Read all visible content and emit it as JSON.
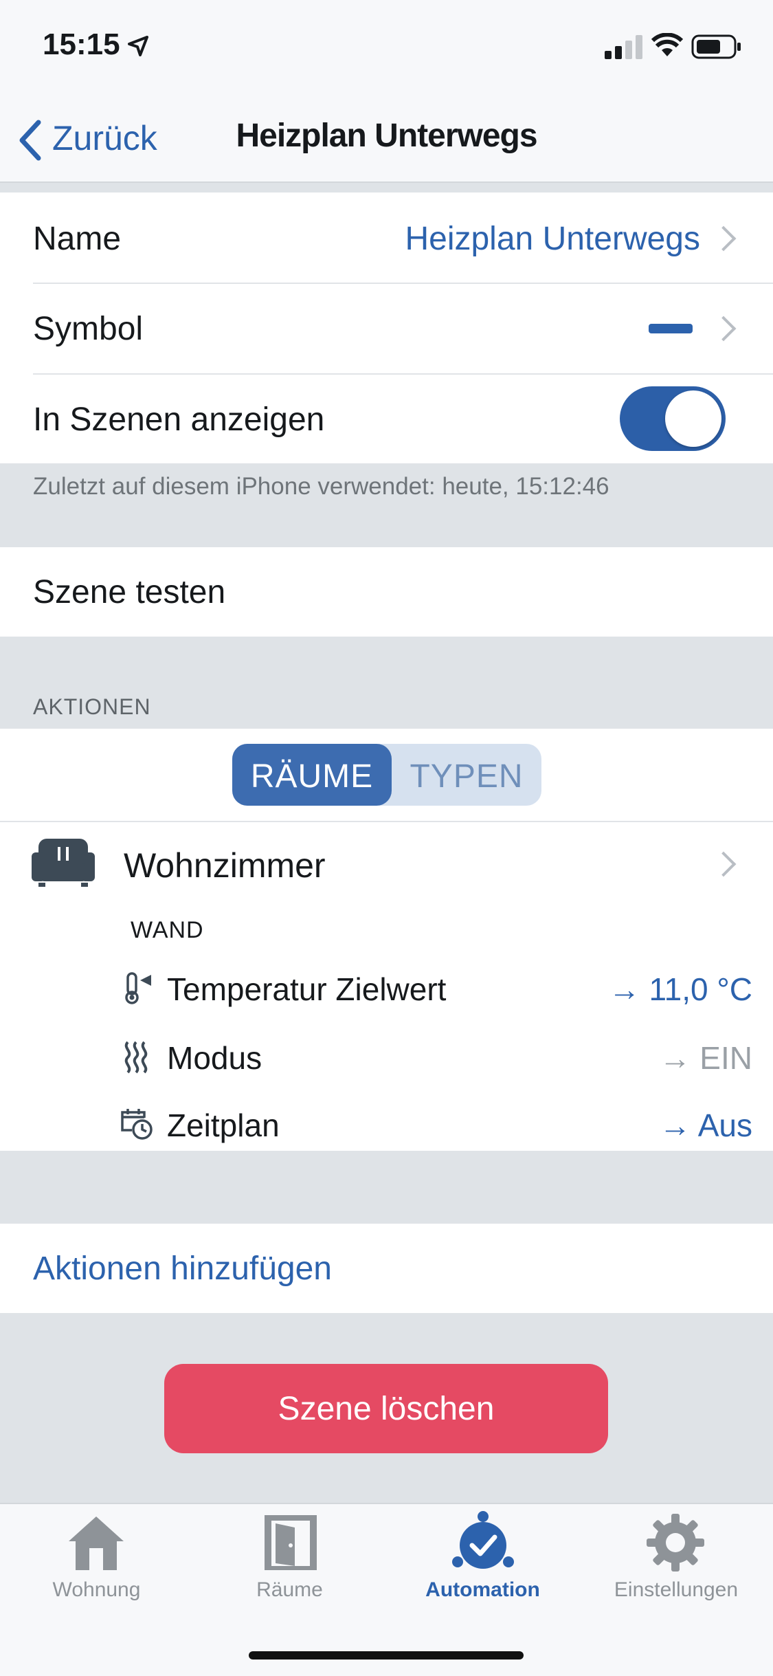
{
  "status_bar": {
    "time": "15:15"
  },
  "nav": {
    "back_label": "Zurück",
    "title": "Heizplan Unterwegs"
  },
  "settings": {
    "name_label": "Name",
    "name_value": "Heizplan Unterwegs",
    "symbol_label": "Symbol",
    "show_in_scenes_label": "In Szenen anzeigen",
    "show_in_scenes_on": true,
    "last_used": "Zuletzt auf diesem iPhone verwendet: heute, 15:12:46"
  },
  "test_scene_label": "Szene testen",
  "actions": {
    "header": "AKTIONEN",
    "segments": [
      "RÄUME",
      "TYPEN"
    ],
    "selected_segment": "RÄUME",
    "room": {
      "name": "Wohnzimmer",
      "device": "WAND",
      "items": [
        {
          "icon": "thermometer-icon",
          "label": "Temperatur Zielwert",
          "value": "→ 11,0 °C"
        },
        {
          "icon": "heat-waves-icon",
          "label": "Modus",
          "value": "→ EIN"
        },
        {
          "icon": "calendar-clock-icon",
          "label": "Zeitplan",
          "value": "→ Aus"
        }
      ]
    },
    "add_label": "Aktionen hinzufügen"
  },
  "delete_button": "Szene löschen",
  "tabbar": {
    "items": [
      {
        "icon": "house-icon",
        "label": "Wohnung"
      },
      {
        "icon": "door-icon",
        "label": "Räume"
      },
      {
        "icon": "automation-icon",
        "label": "Automation"
      },
      {
        "icon": "gear-icon",
        "label": "Einstellungen"
      }
    ],
    "active": "Automation"
  },
  "colors": {
    "accent": "#2c62ad",
    "danger": "#e54a63",
    "background": "#dfe3e7"
  }
}
